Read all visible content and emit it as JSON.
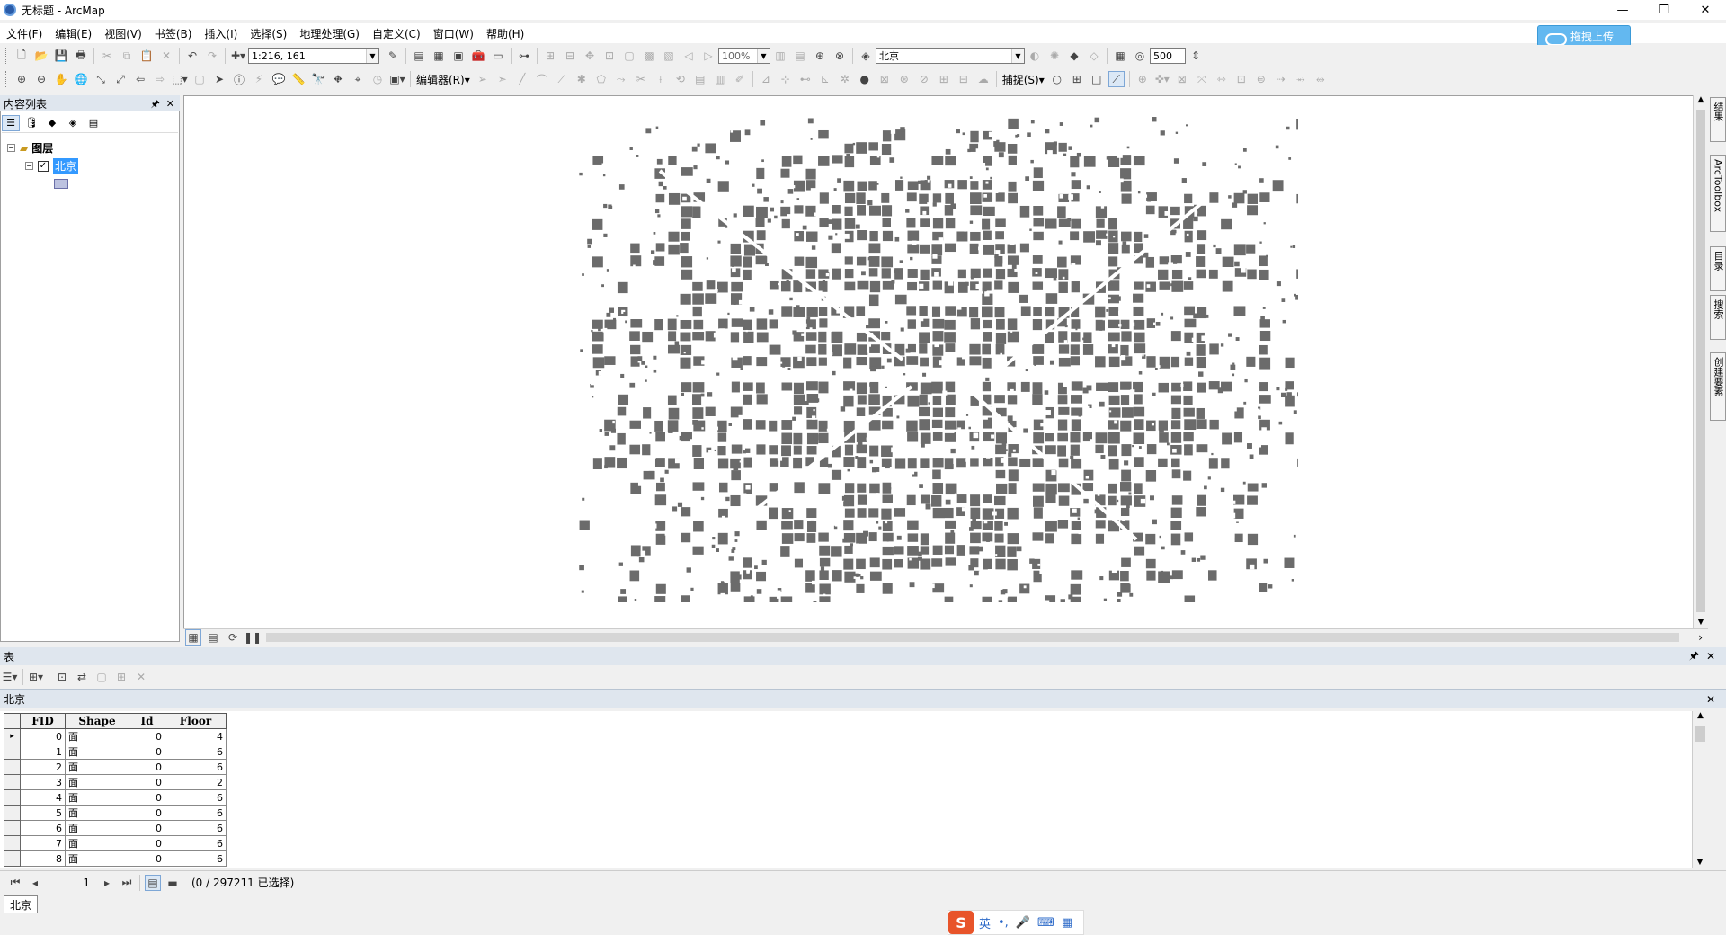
{
  "window": {
    "title": "无标题 - ArcMap",
    "minimize": "—",
    "restore": "❐",
    "close": "✕"
  },
  "menu": [
    "文件(F)",
    "编辑(E)",
    "视图(V)",
    "书签(B)",
    "插入(I)",
    "选择(S)",
    "地理处理(G)",
    "自定义(C)",
    "窗口(W)",
    "帮助(H)"
  ],
  "upload": {
    "label": "拖拽上传"
  },
  "toolbar1": {
    "scale": "1:216, 161",
    "zoom_percent": "100%",
    "layer_select": "北京",
    "buffer_value": "500"
  },
  "toolbar2": {
    "editor_label": "编辑器(R)▾",
    "snapping_label": "捕捉(S)▾"
  },
  "toc": {
    "title": "内容列表",
    "root": "图层",
    "layer": "北京",
    "layer_checked": true
  },
  "dock_tabs": [
    "结果",
    "ArcToolbox",
    "目录",
    "搜索",
    "创建要素"
  ],
  "table_window": {
    "title": "表",
    "table_name": "北京",
    "columns": [
      "FID",
      "Shape",
      "Id",
      "Floor"
    ],
    "rows": [
      [
        "0",
        "面",
        "0",
        "4"
      ],
      [
        "1",
        "面",
        "0",
        "6"
      ],
      [
        "2",
        "面",
        "0",
        "6"
      ],
      [
        "3",
        "面",
        "0",
        "2"
      ],
      [
        "4",
        "面",
        "0",
        "6"
      ],
      [
        "5",
        "面",
        "0",
        "6"
      ],
      [
        "6",
        "面",
        "0",
        "6"
      ],
      [
        "7",
        "面",
        "0",
        "6"
      ],
      [
        "8",
        "面",
        "0",
        "6"
      ]
    ],
    "current_record": "1",
    "selection_status": "(0 / 297211 已选择)",
    "bottom_tab": "北京"
  },
  "ime": {
    "logo": "S",
    "lang": "英",
    "punct": "•,",
    "mic": "🎤",
    "keyboard": "⌨",
    "grid": "▦"
  },
  "colors": {
    "building": "#6b6b6b",
    "toc_selected": "#3399ff",
    "upload_bg": "#63b8f0",
    "panel_header": "#dfe6ee"
  }
}
